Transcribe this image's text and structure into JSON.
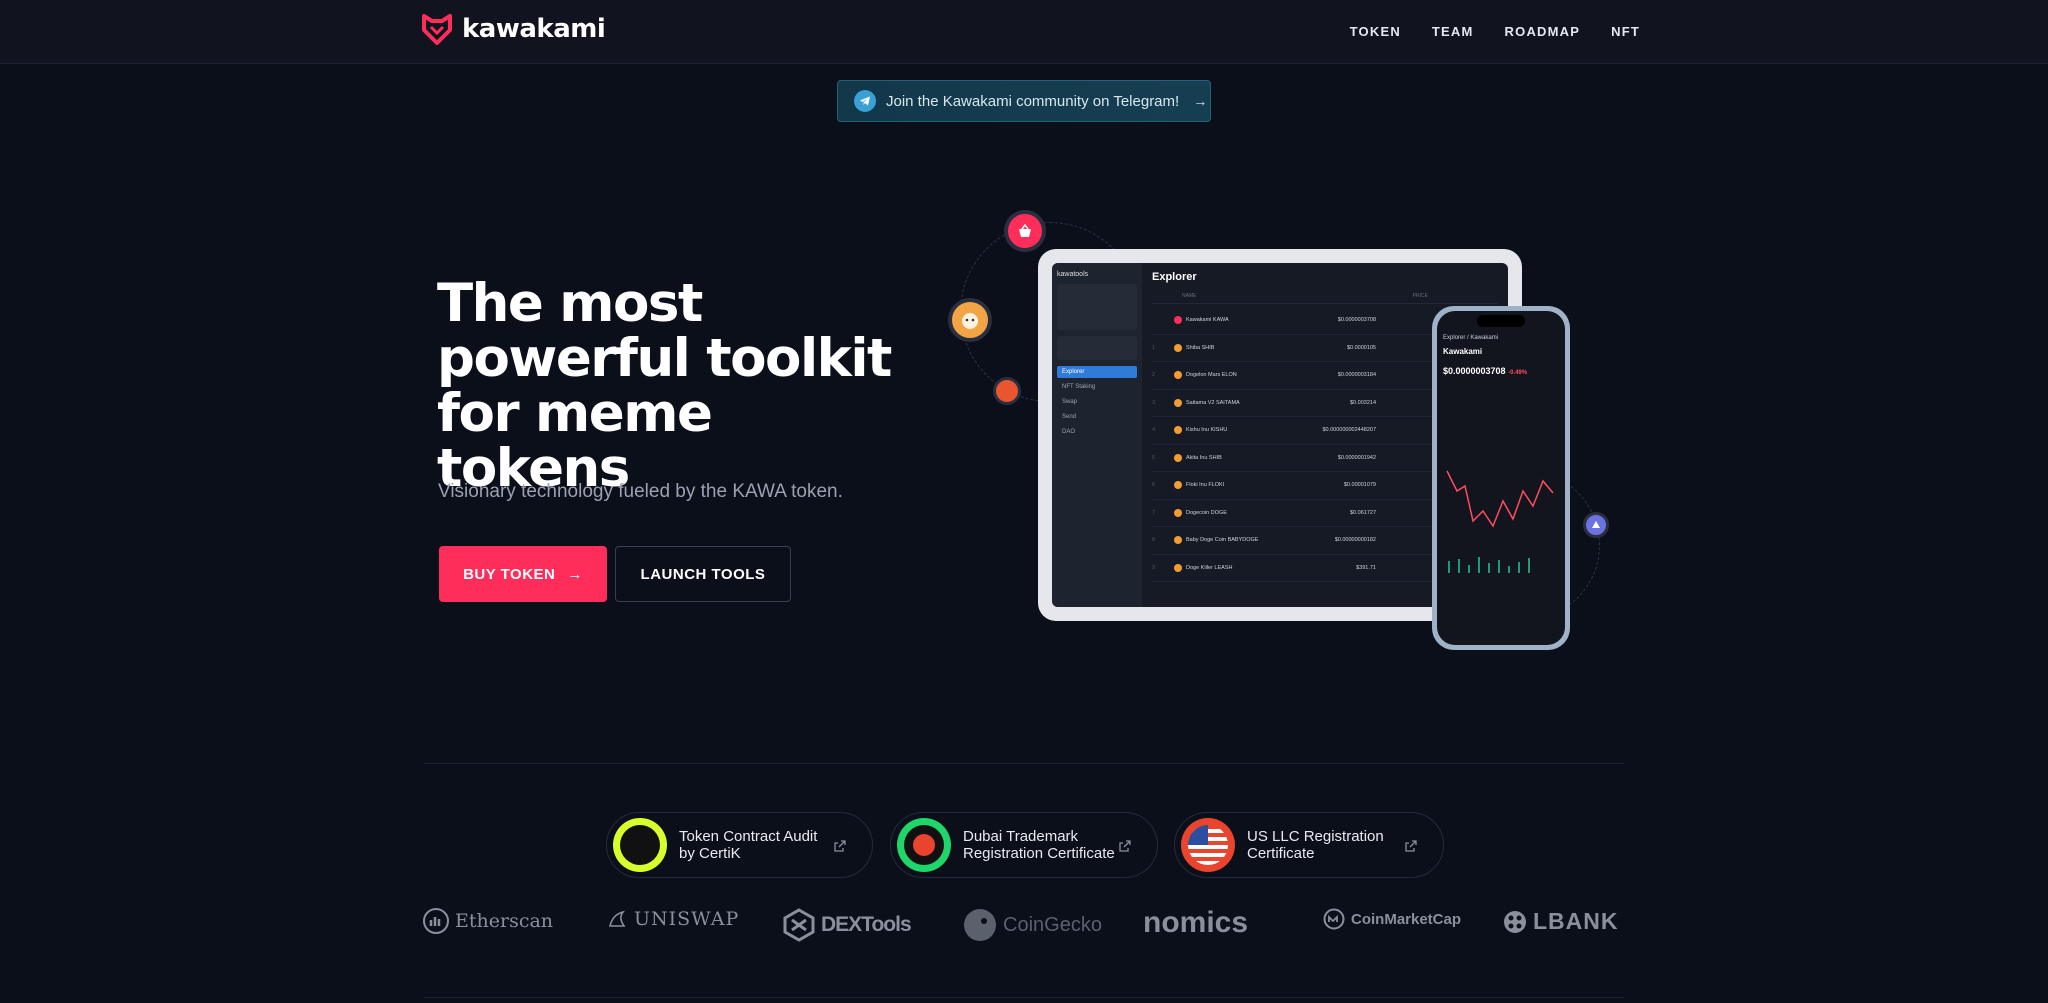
{
  "header": {
    "brand": "kawakami",
    "nav": [
      "TOKEN",
      "TEAM",
      "ROADMAP",
      "NFT"
    ],
    "brand_color": "#ff2d5a"
  },
  "banner": {
    "text": "Join the Kawakami community on Telegram!",
    "arrow": "→",
    "icon": "telegram-icon"
  },
  "hero": {
    "title_lines": [
      "The most",
      "powerful toolkit",
      "for meme tokens"
    ],
    "subtitle": "Visionary technology fueled by the KAWA token.",
    "buy_label": "BUY TOKEN",
    "buy_arrow": "→",
    "launch_label": "LAUNCH TOOLS"
  },
  "tablet": {
    "brand": "kawatools",
    "title": "Explorer",
    "sidebar": [
      "Explorer",
      "NFT Staking",
      "Swap",
      "Send",
      "DAO"
    ],
    "columns": [
      "NAME",
      "PRICE"
    ],
    "rows": [
      {
        "rank": "",
        "name": "Kawakami KAWA",
        "price": "$0.0000003708"
      },
      {
        "rank": "1",
        "name": "Shiba SHIB",
        "price": "$0.0000105"
      },
      {
        "rank": "2",
        "name": "Dogelon Mars ELON",
        "price": "$0.0000003184"
      },
      {
        "rank": "3",
        "name": "Saitama V2 SAITAMA",
        "price": "$0.003214"
      },
      {
        "rank": "4",
        "name": "Kishu Inu KISHU",
        "price": "$0.000000002448207"
      },
      {
        "rank": "5",
        "name": "Akita Inu SHIB",
        "price": "$0.0000001942"
      },
      {
        "rank": "6",
        "name": "Floki Inu FLOKI",
        "price": "$0.00001079"
      },
      {
        "rank": "7",
        "name": "Dogecoin DOGE",
        "price": "$0.061727"
      },
      {
        "rank": "8",
        "name": "Baby Doge Coin BABYDOGE",
        "price": "$0.00000000182"
      },
      {
        "rank": "9",
        "name": "Doge Killer LEASH",
        "price": "$391.71"
      }
    ]
  },
  "phone": {
    "crumb": "Explorer / Kawakami",
    "token": "Kawakami",
    "price": "$0.0000003708",
    "change": "-0.49%"
  },
  "certificates": [
    {
      "label_line1": "Token Contract Audit",
      "label_line2": "by CertiK",
      "color": "#d8ff2a"
    },
    {
      "label_line1": "Dubai Trademark",
      "label_line2": "Registration Certificate",
      "color": "#1fd66a"
    },
    {
      "label_line1": "US LLC Registration",
      "label_line2": "Certificate",
      "color": "#e8442e"
    }
  ],
  "partners": [
    "Etherscan",
    "UNISWAP",
    "DEXTools",
    "CoinGecko",
    "nomics",
    "CoinMarketCap",
    "LBANK"
  ]
}
